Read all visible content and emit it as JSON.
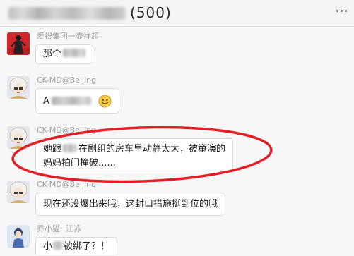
{
  "header": {
    "member_count": "(500)"
  },
  "messages": [
    {
      "sender": "爱祝集团一壶祥超",
      "text": "那个"
    },
    {
      "sender": "CK-MD@Beijing",
      "text": "A",
      "emoji": "smiley-emoji-icon"
    },
    {
      "sender": "CK-MD@Beijing",
      "line1_start": "她跟",
      "line1_end": "在剧组的房车里动静太大，被童演的",
      "line2": "妈妈拍门撞破......"
    },
    {
      "sender": "CK-MD@Beijing",
      "text": "现在还没爆出来哦，这封口措施挺到位的哦"
    },
    {
      "sender": "乔小猫",
      "location": "江苏",
      "text_start": "小",
      "text_end": "被绑了？！"
    }
  ],
  "icons": {
    "header_menu": "more-icon",
    "message_emoji": "smiley-emoji-icon"
  },
  "colors": {
    "highlight": "#e31e24",
    "bubble_border": "#d9d9d9",
    "sender_name": "#9e9e9e",
    "message_text": "#1c1c1c"
  }
}
